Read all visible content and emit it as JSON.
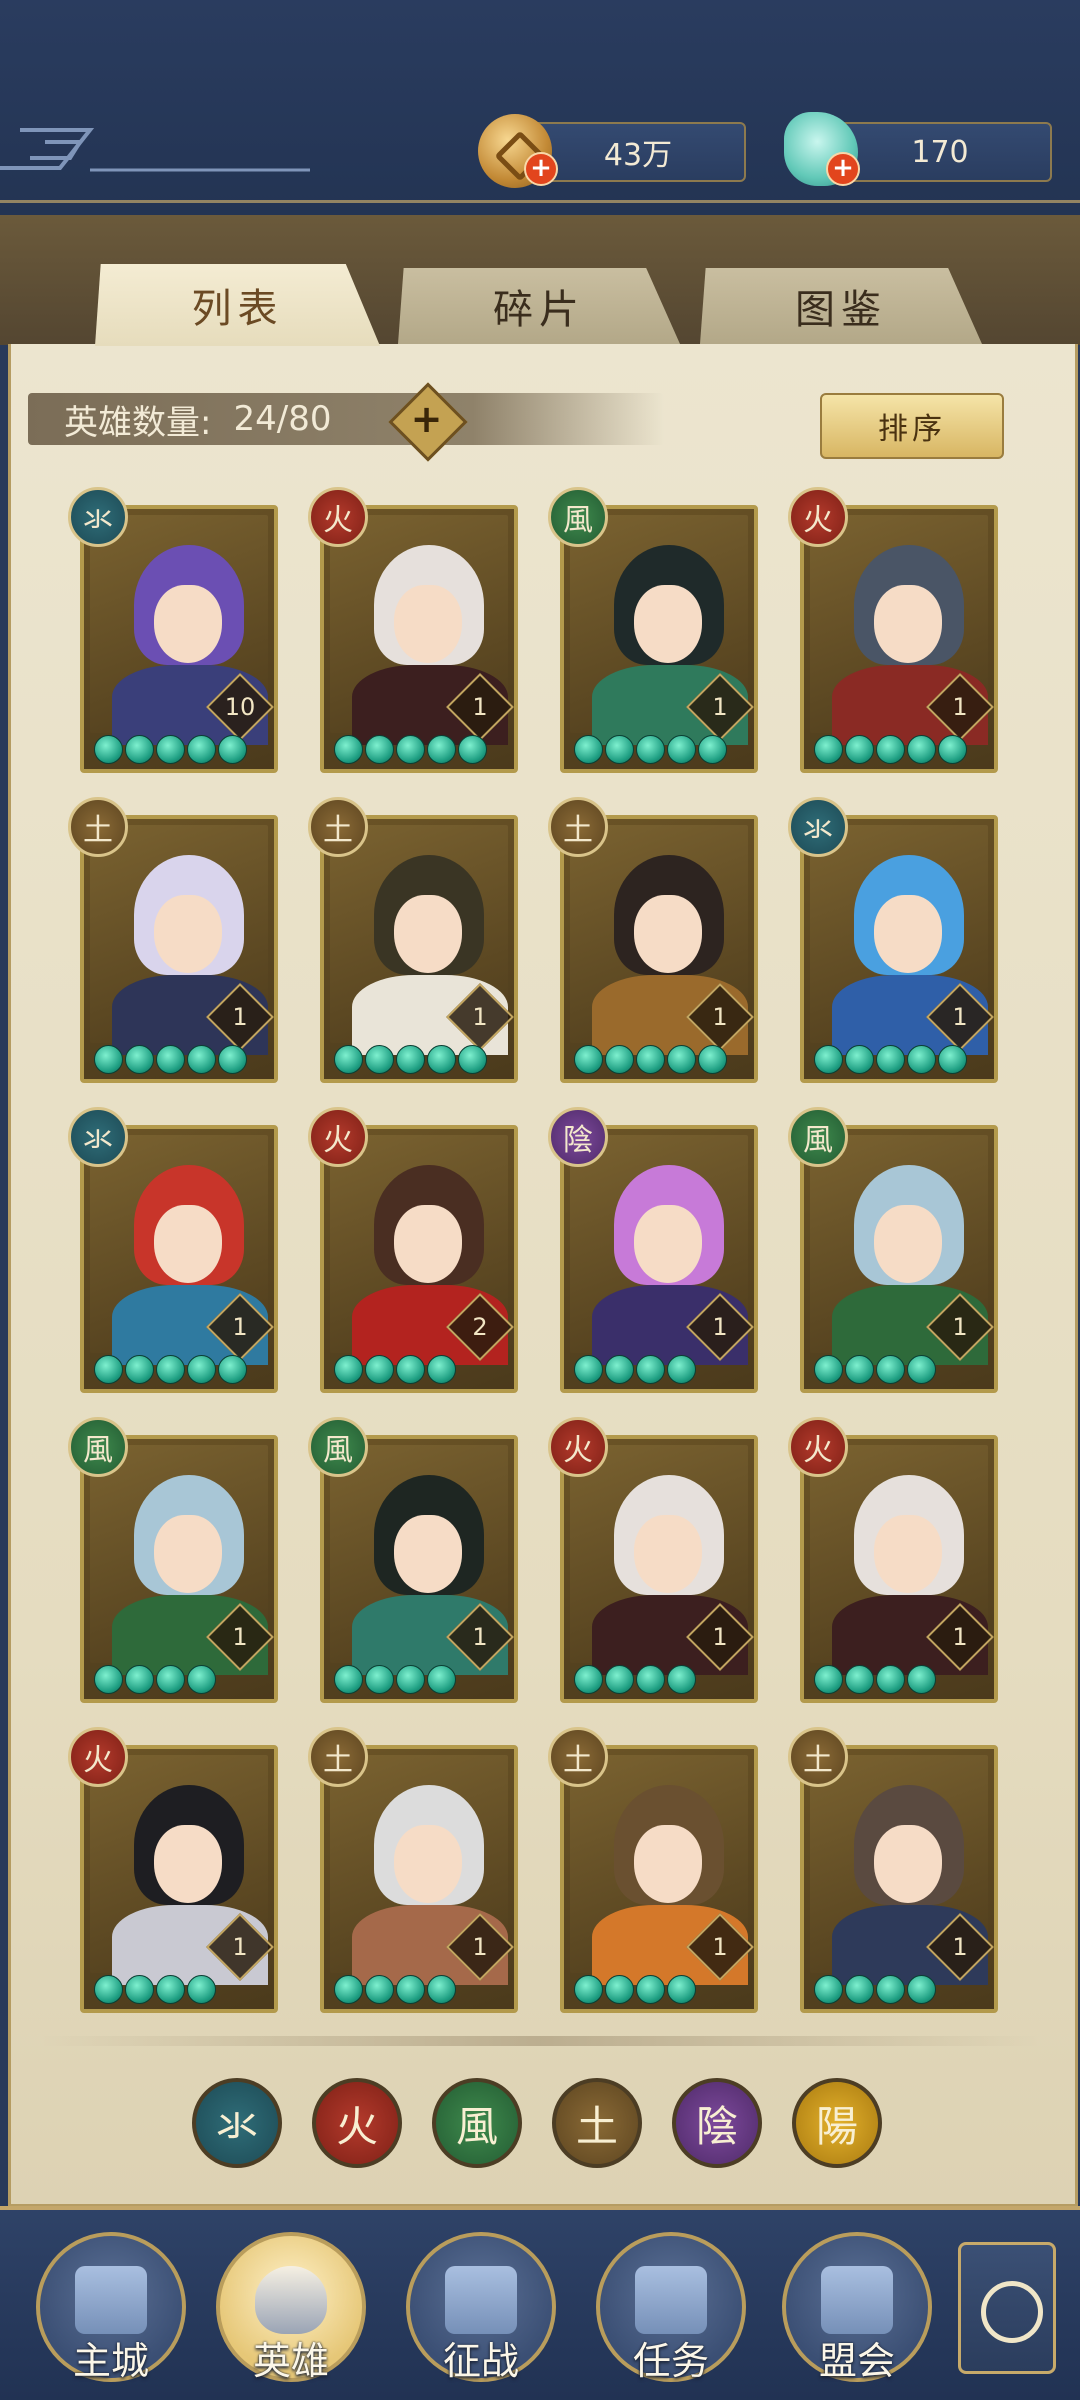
{
  "resources": {
    "coin": {
      "value": "43万",
      "icon": "coin-icon"
    },
    "gem": {
      "value": "170",
      "icon": "jade-gem-icon"
    }
  },
  "tabs": [
    {
      "label": "列表",
      "active": true
    },
    {
      "label": "碎片",
      "active": false
    },
    {
      "label": "图鉴",
      "active": false
    }
  ],
  "hero_count": {
    "label": "英雄数量:",
    "value": "24/80"
  },
  "sort_label": "排序",
  "heroes": [
    {
      "element": "氺",
      "type": "water",
      "level": "10",
      "stars": 5,
      "hair": "#6b4fb3",
      "outfit": "#3a3f7a"
    },
    {
      "element": "火",
      "type": "fire",
      "level": "1",
      "stars": 5,
      "hair": "#e6e0dc",
      "outfit": "#3c1f1f"
    },
    {
      "element": "風",
      "type": "wind",
      "level": "1",
      "stars": 5,
      "hair": "#1f2a2a",
      "outfit": "#2f7a5c"
    },
    {
      "element": "火",
      "type": "fire",
      "level": "1",
      "stars": 5,
      "hair": "#4a5566",
      "outfit": "#8a2a24"
    },
    {
      "element": "土",
      "type": "earth",
      "level": "1",
      "stars": 5,
      "hair": "#d9d4ec",
      "outfit": "#2e3558"
    },
    {
      "element": "土",
      "type": "earth",
      "level": "1",
      "stars": 5,
      "hair": "#3a3524",
      "outfit": "#e9e4d8"
    },
    {
      "element": "土",
      "type": "earth",
      "level": "1",
      "stars": 5,
      "hair": "#2d2420",
      "outfit": "#9a6a2c"
    },
    {
      "element": "氺",
      "type": "water",
      "level": "1",
      "stars": 5,
      "hair": "#4aa0e0",
      "outfit": "#2f5fa8"
    },
    {
      "element": "氺",
      "type": "water",
      "level": "1",
      "stars": 5,
      "hair": "#c8352a",
      "outfit": "#2f7aa0"
    },
    {
      "element": "火",
      "type": "fire",
      "level": "2",
      "stars": 4,
      "hair": "#4a2e22",
      "outfit": "#b3231f"
    },
    {
      "element": "陰",
      "type": "yin",
      "level": "1",
      "stars": 4,
      "hair": "#c77ad8",
      "outfit": "#3a2f6a"
    },
    {
      "element": "風",
      "type": "wind",
      "level": "1",
      "stars": 4,
      "hair": "#a8c6d6",
      "outfit": "#2e6a3a"
    },
    {
      "element": "風",
      "type": "wind",
      "level": "1",
      "stars": 4,
      "hair": "#a8c6d6",
      "outfit": "#2e6a3a"
    },
    {
      "element": "風",
      "type": "wind",
      "level": "1",
      "stars": 4,
      "hair": "#1e2622",
      "outfit": "#2f7a6a"
    },
    {
      "element": "火",
      "type": "fire",
      "level": "1",
      "stars": 4,
      "hair": "#e6e0dc",
      "outfit": "#3c1f1f"
    },
    {
      "element": "火",
      "type": "fire",
      "level": "1",
      "stars": 4,
      "hair": "#e6e0dc",
      "outfit": "#3c1f1f"
    },
    {
      "element": "火",
      "type": "fire",
      "level": "1",
      "stars": 4,
      "hair": "#1e1e22",
      "outfit": "#c9c9d2"
    },
    {
      "element": "土",
      "type": "earth",
      "level": "1",
      "stars": 4,
      "hair": "#dcdcdc",
      "outfit": "#a5694a"
    },
    {
      "element": "土",
      "type": "earth",
      "level": "1",
      "stars": 4,
      "hair": "#6a5030",
      "outfit": "#d4782a"
    },
    {
      "element": "土",
      "type": "earth",
      "level": "1",
      "stars": 4,
      "hair": "#5a4a40",
      "outfit": "#2e3a5a"
    }
  ],
  "filters": [
    {
      "label": "氺",
      "type": "water"
    },
    {
      "label": "火",
      "type": "fire"
    },
    {
      "label": "風",
      "type": "wind"
    },
    {
      "label": "土",
      "type": "earth"
    },
    {
      "label": "陰",
      "type": "yin"
    },
    {
      "label": "陽",
      "type": "yang"
    }
  ],
  "nav": [
    {
      "label": "主城",
      "icon": "palace-icon",
      "active": false
    },
    {
      "label": "英雄",
      "icon": "hero-portrait-icon",
      "active": true
    },
    {
      "label": "征战",
      "icon": "campaign-icon",
      "active": false
    },
    {
      "label": "任务",
      "icon": "task-scroll-icon",
      "active": false
    },
    {
      "label": "盟会",
      "icon": "alliance-icon",
      "active": false
    }
  ],
  "side_button_icon": "flower-menu-icon"
}
